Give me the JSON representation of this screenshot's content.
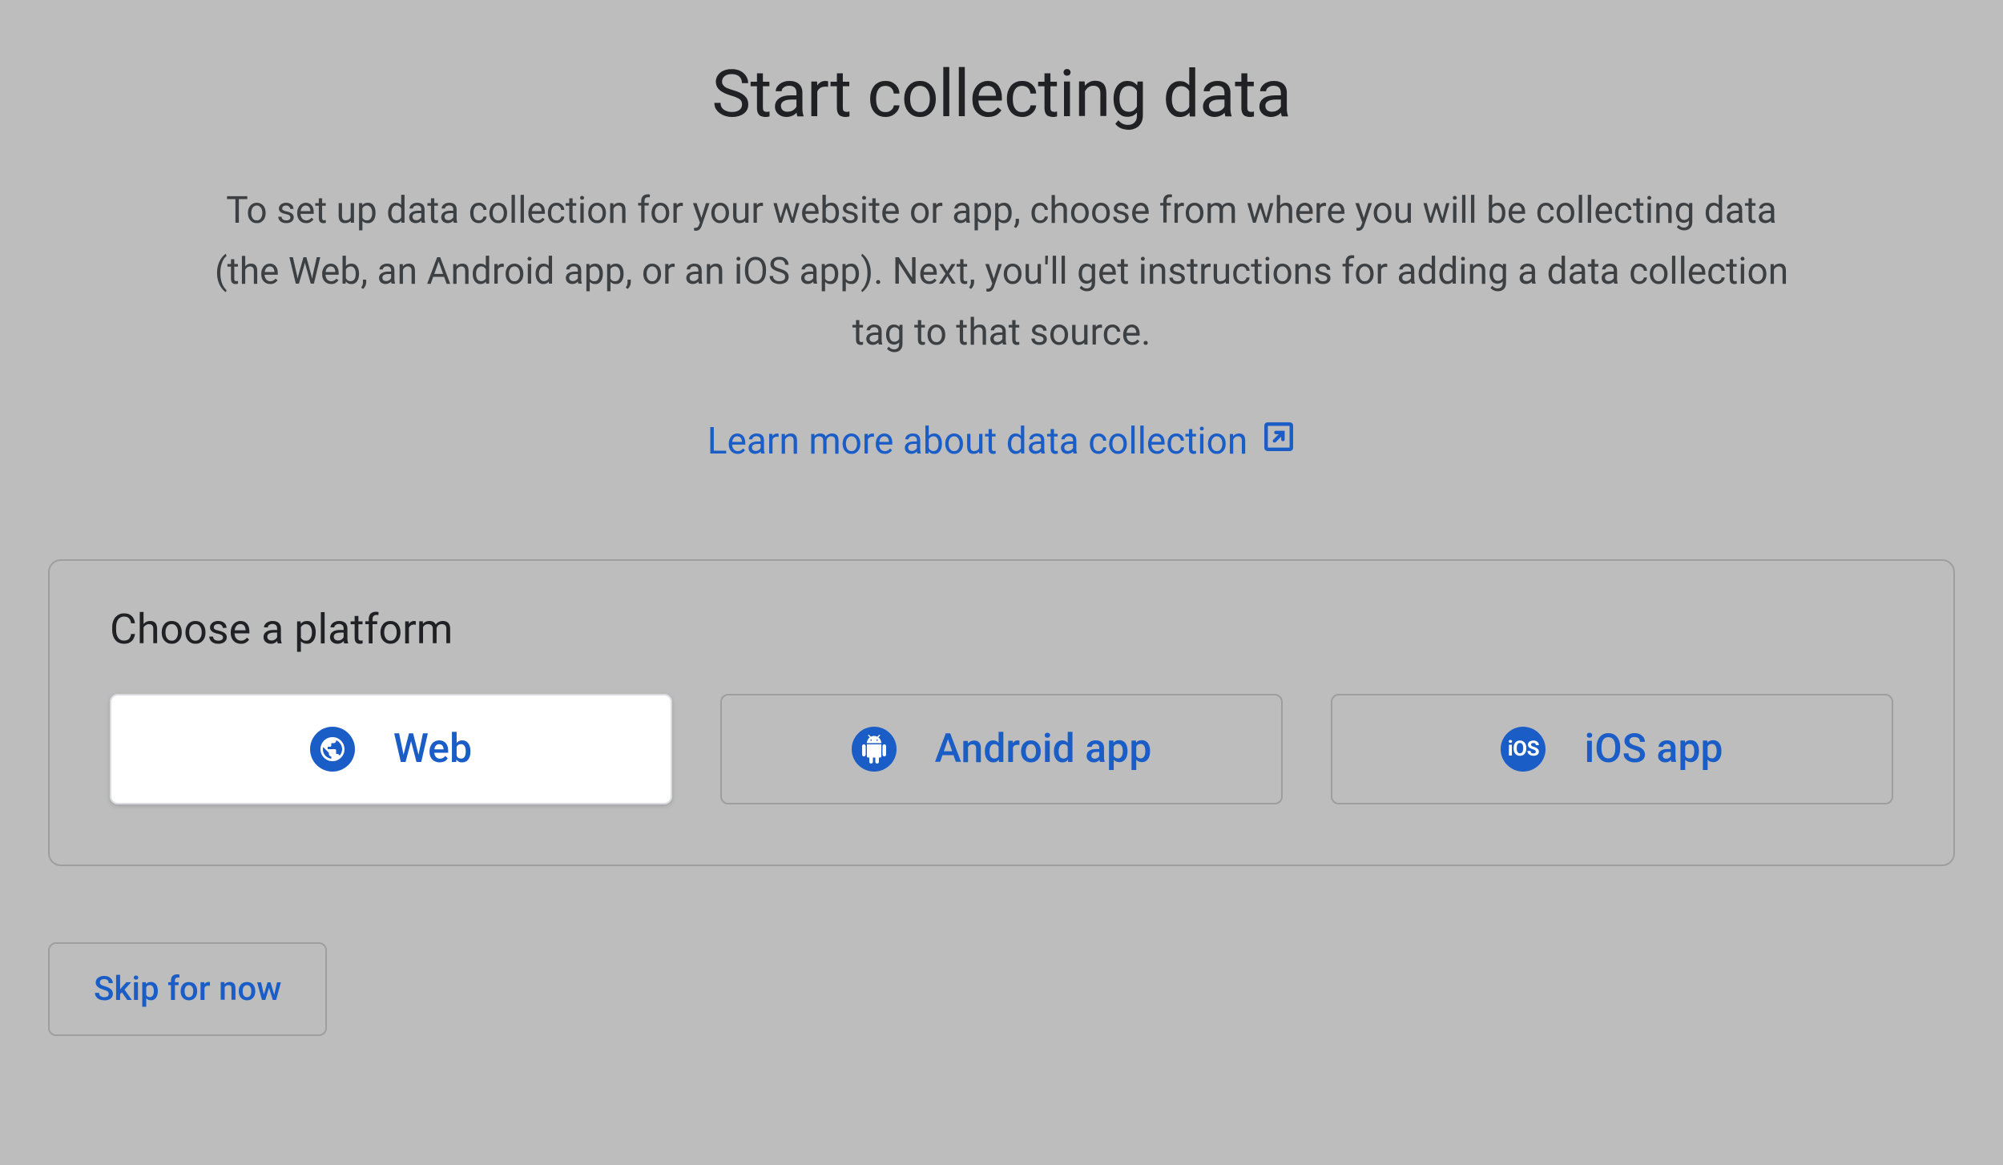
{
  "header": {
    "title": "Start collecting data",
    "description": "To set up data collection for your website or app, choose from where you will be collecting data (the Web, an Android app, or an iOS app). Next, you'll get instructions for adding a data collection tag to that source.",
    "learn_more_label": "Learn more about data collection"
  },
  "platform": {
    "heading": "Choose a platform",
    "options": {
      "web": "Web",
      "android": "Android app",
      "ios": "iOS app"
    },
    "ios_icon_text": "iOS"
  },
  "actions": {
    "skip_label": "Skip for now"
  },
  "colors": {
    "accent": "#1a5dc7",
    "text_primary": "#202124",
    "text_secondary": "#3c4043",
    "background": "#bdbdbd",
    "border": "#9e9e9e"
  }
}
